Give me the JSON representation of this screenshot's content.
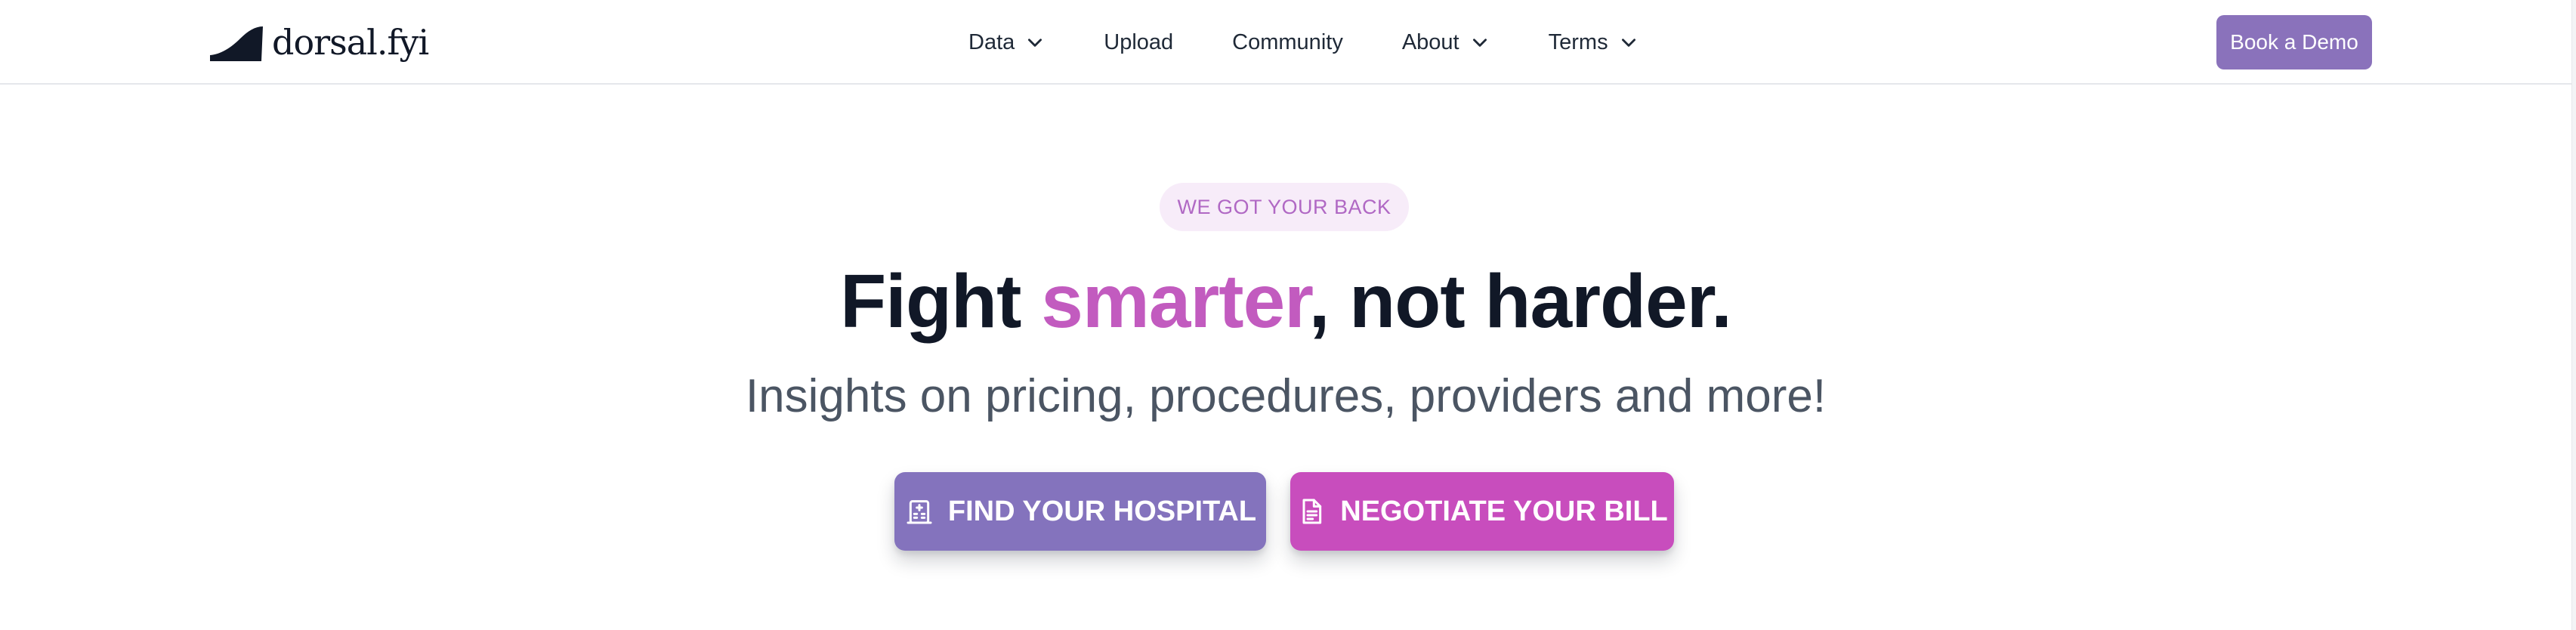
{
  "brand": {
    "name": "dorsal.fyi"
  },
  "nav": {
    "items": [
      {
        "label": "Data",
        "has_dropdown": true
      },
      {
        "label": "Upload",
        "has_dropdown": false
      },
      {
        "label": "Community",
        "has_dropdown": false
      },
      {
        "label": "About",
        "has_dropdown": true
      },
      {
        "label": "Terms",
        "has_dropdown": true
      }
    ],
    "cta_label": "Book a Demo"
  },
  "hero": {
    "badge": "WE GOT YOUR BACK",
    "headline_before": "Fight ",
    "headline_accent": "smarter",
    "headline_after": ", not harder.",
    "subheadline": "Insights on pricing, procedures, providers and more!",
    "primary_button": {
      "label": "FIND YOUR HOSPITAL",
      "icon": "hospital-icon"
    },
    "secondary_button": {
      "label": "NEGOTIATE YOUR BILL",
      "icon": "document-icon"
    }
  },
  "colors": {
    "brand_purple": "#8a72bb",
    "accent_pink": "#c25bbf",
    "badge_bg": "#f7ecf9",
    "badge_text": "#b068c4",
    "headline": "#111827",
    "subheadline": "#4b5563",
    "primary_button": "#8473bd",
    "secondary_button": "#c84dbd"
  }
}
